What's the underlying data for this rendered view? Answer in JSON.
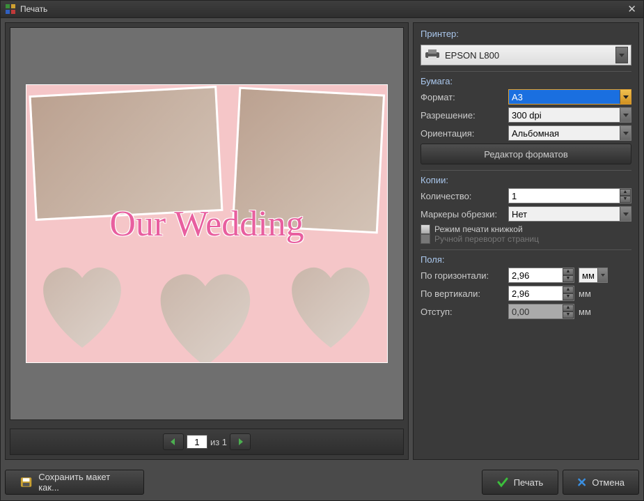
{
  "window": {
    "title": "Печать"
  },
  "preview": {
    "script_text": "Our Wedding",
    "pager": {
      "current": "1",
      "of_label": "из 1"
    }
  },
  "printer": {
    "section": "Принтер:",
    "selected": "EPSON L800"
  },
  "paper": {
    "section": "Бумага:",
    "format_label": "Формат:",
    "format_value": "A3",
    "resolution_label": "Разрешение:",
    "resolution_value": "300 dpi",
    "orientation_label": "Ориентация:",
    "orientation_value": "Альбомная",
    "editor_btn": "Редактор форматов"
  },
  "copies": {
    "section": "Копии:",
    "count_label": "Количество:",
    "count_value": "1",
    "crop_label": "Маркеры обрезки:",
    "crop_value": "Нет",
    "booklet_label": "Режим печати книжкой",
    "manual_flip_label": "Ручной переворот страниц"
  },
  "margins": {
    "section": "Поля:",
    "horiz_label": "По горизонтали:",
    "horiz_value": "2,96",
    "vert_label": "По вертикали:",
    "vert_value": "2,96",
    "indent_label": "Отступ:",
    "indent_value": "0,00",
    "unit": "мм"
  },
  "footer": {
    "save_as": "Сохранить макет как...",
    "print": "Печать",
    "cancel": "Отмена"
  }
}
